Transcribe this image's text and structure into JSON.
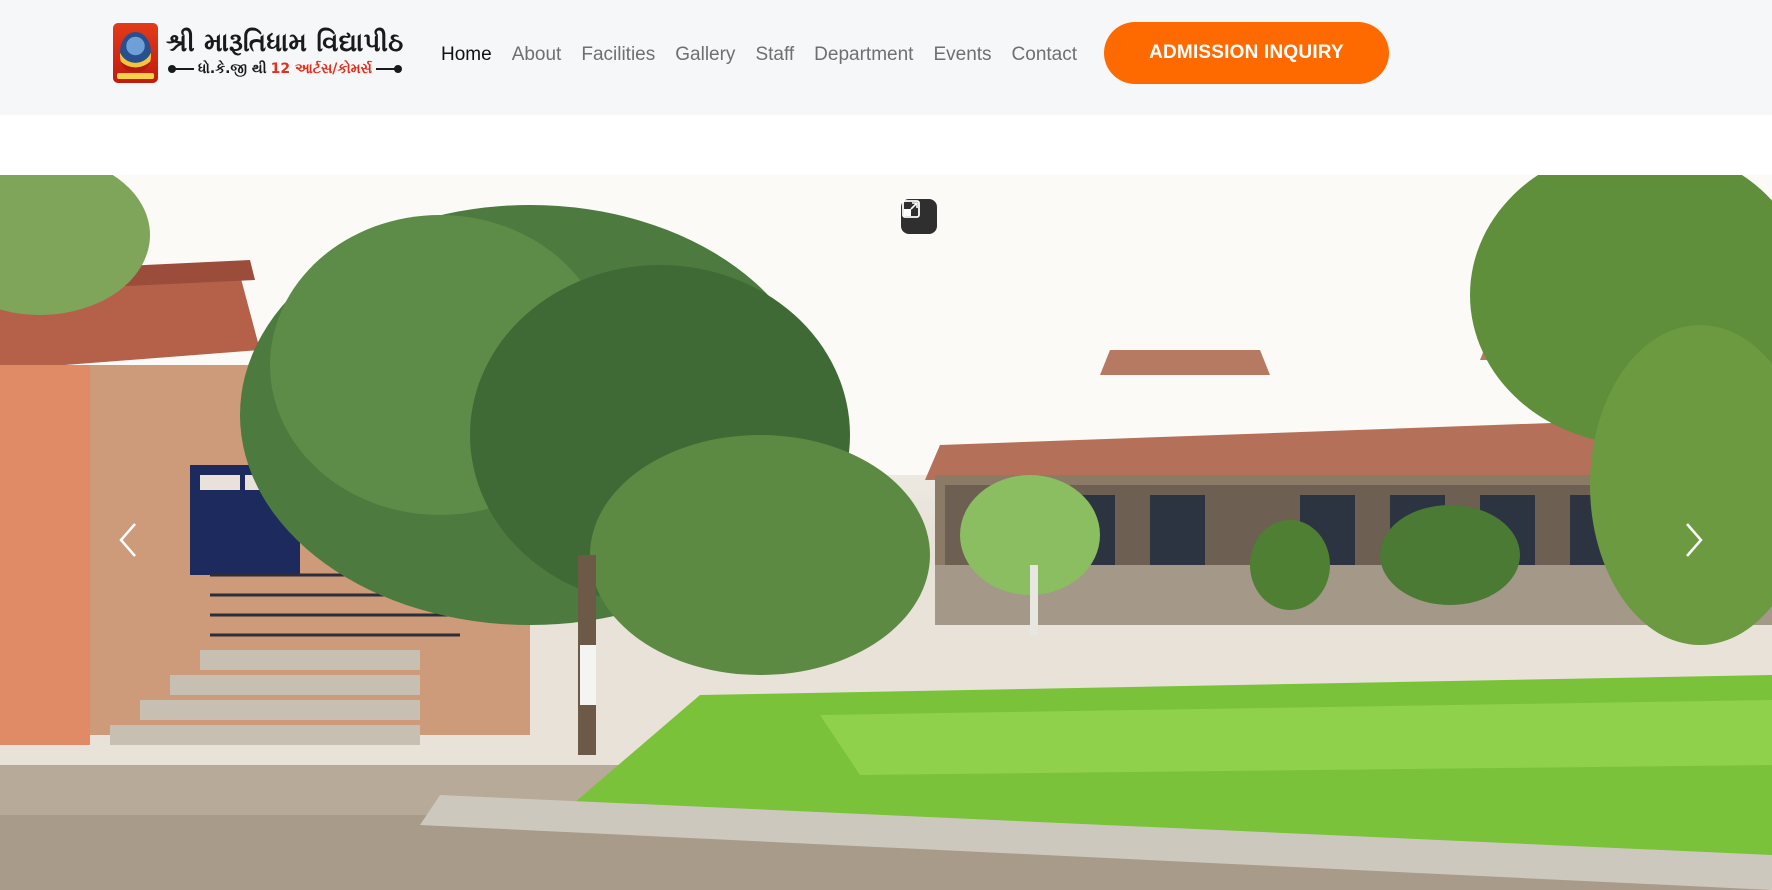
{
  "brand": {
    "title": "શ્રી મારૂતિધામ વિદ્યાપીઠ",
    "subtitle_black": "ધો.કે.જી થી",
    "subtitle_red": "12 આર્ટસ/કોમર્સ"
  },
  "nav": {
    "items": [
      {
        "label": "Home",
        "active": true
      },
      {
        "label": "About",
        "active": false
      },
      {
        "label": "Facilities",
        "active": false
      },
      {
        "label": "Gallery",
        "active": false
      },
      {
        "label": "Staff",
        "active": false
      },
      {
        "label": "Department",
        "active": false
      },
      {
        "label": "Events",
        "active": false
      },
      {
        "label": "Contact",
        "active": false
      }
    ]
  },
  "cta": {
    "label": "ADMISSION INQUIRY"
  },
  "hero": {
    "description_icons": [
      "fullscreen-exit-icon",
      "chevron-left-icon",
      "chevron-right-icon"
    ]
  },
  "colors": {
    "accent": "#ff6a00",
    "header_bg": "#f6f7f9",
    "nav_active": "#111111",
    "nav_inactive": "#6f6f6f"
  }
}
